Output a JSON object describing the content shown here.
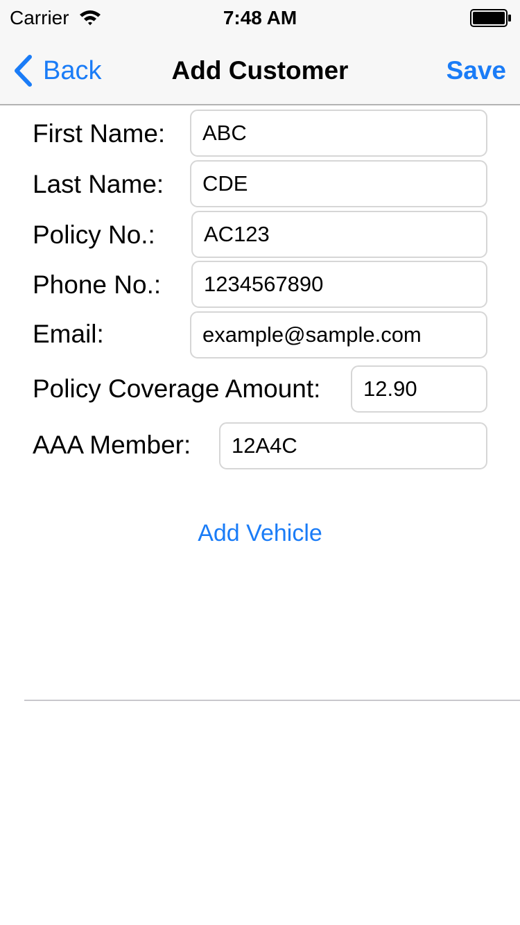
{
  "status_bar": {
    "carrier": "Carrier",
    "time": "7:48 AM",
    "wifi_icon": "wifi-icon",
    "battery_icon": "battery-icon"
  },
  "nav": {
    "back_label": "Back",
    "back_icon": "chevron-left-icon",
    "title": "Add Customer",
    "save_label": "Save"
  },
  "form": {
    "first_name": {
      "label": "First Name:",
      "value": "ABC"
    },
    "last_name": {
      "label": "Last Name:",
      "value": "CDE"
    },
    "policy_no": {
      "label": "Policy No.:",
      "value": "AC123"
    },
    "phone_no": {
      "label": "Phone No.:",
      "value": "1234567890"
    },
    "email": {
      "label": "Email:",
      "value": "example@sample.com"
    },
    "coverage": {
      "label": "Policy Coverage Amount:",
      "value": "12.90"
    },
    "aaa_member": {
      "label": "AAA Member:",
      "value": "12A4C"
    }
  },
  "add_vehicle_label": "Add Vehicle",
  "colors": {
    "accent": "#1a7cf7",
    "nav_background": "#f7f7f7",
    "input_border": "#d6d6d6"
  }
}
